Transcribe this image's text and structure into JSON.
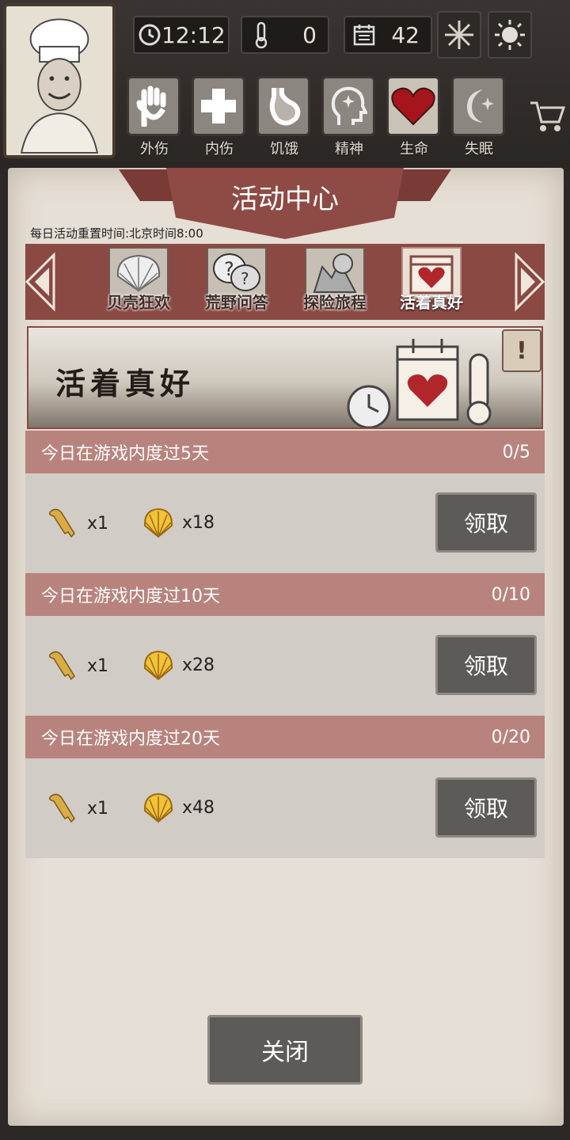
{
  "hud": {
    "time": "12:12",
    "temperature": "0",
    "days": "42",
    "statuses": [
      {
        "label": "外伤",
        "icon": "hand-icon"
      },
      {
        "label": "内伤",
        "icon": "cross-icon"
      },
      {
        "label": "饥饿",
        "icon": "stomach-icon"
      },
      {
        "label": "精神",
        "icon": "head-icon"
      },
      {
        "label": "生命",
        "icon": "heart-icon"
      },
      {
        "label": "失眠",
        "icon": "moon-icon"
      }
    ]
  },
  "panel": {
    "title": "活动中心",
    "reset_time": "每日活动重置时间:北京时间8:00",
    "tabs": [
      {
        "label": "贝壳狂欢",
        "icon": "shell-icon"
      },
      {
        "label": "荒野问答",
        "icon": "question-icon"
      },
      {
        "label": "探险旅程",
        "icon": "map-icon"
      },
      {
        "label": "活着真好",
        "icon": "calendar-heart-icon"
      }
    ],
    "hero_title": "活着真好",
    "info_symbol": "!",
    "tasks": [
      {
        "title": "今日在游戏内度过5天",
        "progress": "0/5",
        "key_count": "x1",
        "shell_count": "x18",
        "button": "领取"
      },
      {
        "title": "今日在游戏内度过10天",
        "progress": "0/10",
        "key_count": "x1",
        "shell_count": "x28",
        "button": "领取"
      },
      {
        "title": "今日在游戏内度过20天",
        "progress": "0/20",
        "key_count": "x1",
        "shell_count": "x48",
        "button": "领取"
      }
    ],
    "close_label": "关闭"
  },
  "colors": {
    "accent_red": "#8a4943",
    "task_header": "#b9837d",
    "button_gray": "#5d5b58",
    "paper": "#e5dfd5"
  }
}
